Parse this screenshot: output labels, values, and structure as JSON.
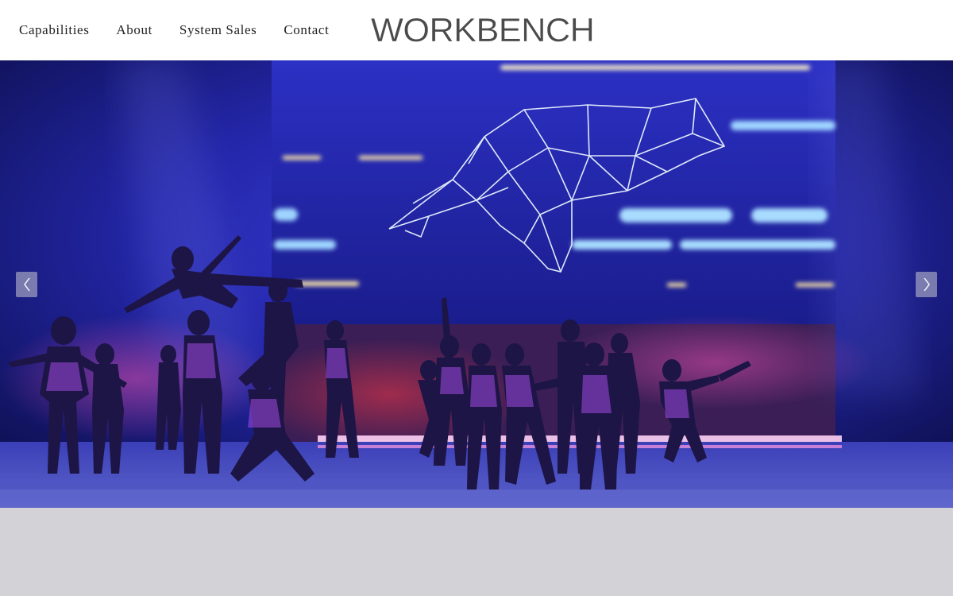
{
  "nav": {
    "items": [
      {
        "label": "Capabilities"
      },
      {
        "label": "About"
      },
      {
        "label": "System Sales"
      },
      {
        "label": "Contact"
      }
    ]
  },
  "brand": {
    "logo_text": "WORKBENCH",
    "logo_color": "#4a4a4a"
  },
  "hero": {
    "slider_prev_icon": "chevron-left-icon",
    "slider_next_icon": "chevron-right-icon"
  },
  "colors": {
    "header_bg": "#ffffff",
    "footer_band_bg": "#d3d2d6",
    "stage_blue": "#1b1f8a"
  }
}
